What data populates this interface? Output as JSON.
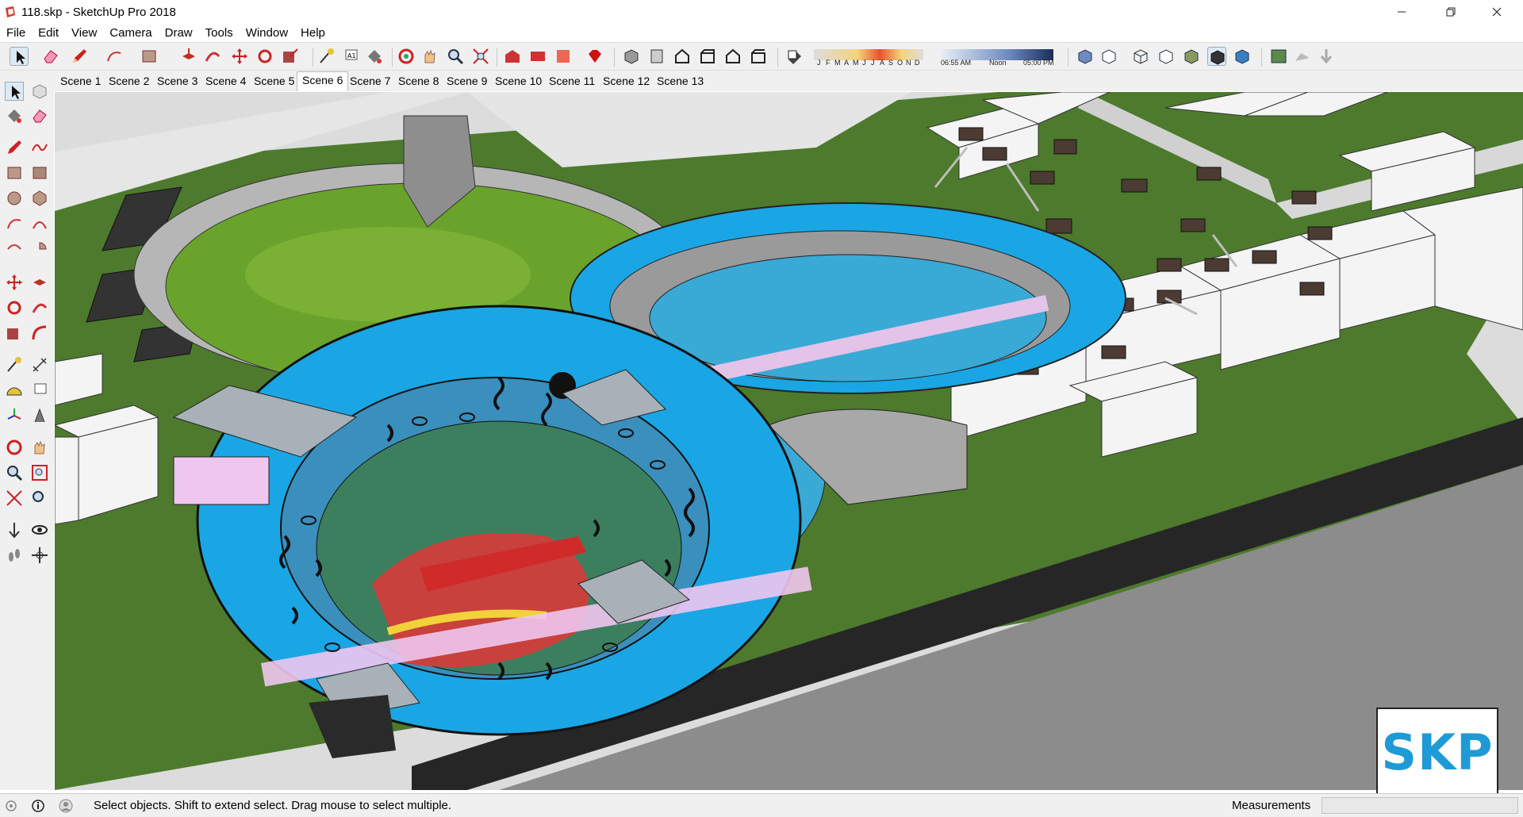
{
  "window": {
    "title": "118.skp - SketchUp Pro 2018",
    "minimize_icon": "minimize-icon",
    "maximize_icon": "restore-icon",
    "close_icon": "close-icon"
  },
  "menu": [
    "File",
    "Edit",
    "View",
    "Camera",
    "Draw",
    "Tools",
    "Window",
    "Help"
  ],
  "toolbar": {
    "months": [
      "J",
      "F",
      "M",
      "A",
      "M",
      "J",
      "J",
      "A",
      "S",
      "O",
      "N",
      "D"
    ],
    "time_start": "06:55 AM",
    "time_mid": "Noon",
    "time_end": "05:00 PM"
  },
  "scenes": {
    "tabs": [
      "Scene 1",
      "Scene 2",
      "Scene 3",
      "Scene 4",
      "Scene 5",
      "Scene 6",
      "Scene 7",
      "Scene 8",
      "Scene 9",
      "Scene 10",
      "Scene 11",
      "Scene 12",
      "Scene 13"
    ],
    "active": "Scene 6"
  },
  "status": {
    "message": "Select objects. Shift to extend select. Drag mouse to select multiple.",
    "measurements_label": "Measurements",
    "measurements_value": ""
  },
  "logo": {
    "text": "SKP"
  },
  "colors": {
    "roof_blue": "#1aa6e4",
    "grass": "#4e7a2a",
    "lawn": "#6aa32c",
    "water": "#39a9d6",
    "road": "#8a8a8a",
    "accent_red": "#d43b2c"
  }
}
